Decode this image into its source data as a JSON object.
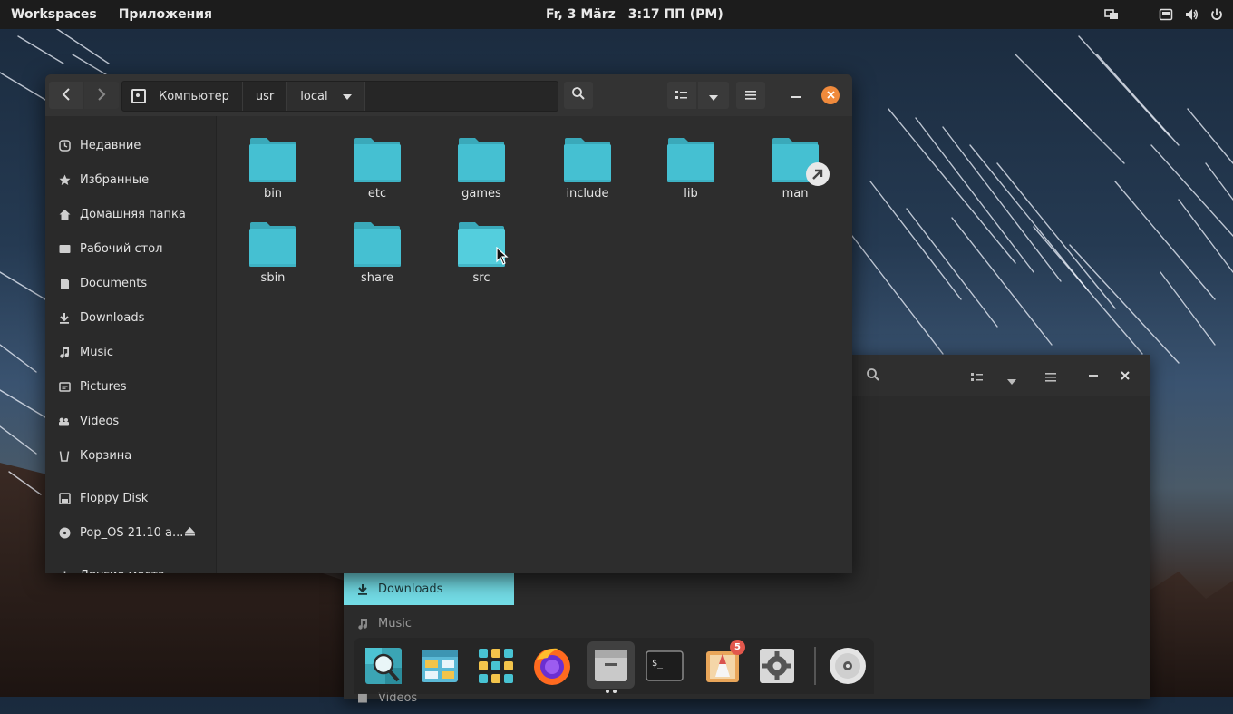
{
  "topbar": {
    "workspaces": "Workspaces",
    "apps": "Приложения",
    "date": "Fr, 3 März",
    "time": "3:17 ПП (PM)"
  },
  "window": {
    "pathbar": [
      "Компьютер",
      "usr",
      "local"
    ]
  },
  "sidebar": {
    "items": [
      {
        "label": "Недавние",
        "icon": "clock-icon"
      },
      {
        "label": "Избранные",
        "icon": "star-icon"
      },
      {
        "label": "Домашняя папка",
        "icon": "home-icon"
      },
      {
        "label": "Рабочий стол",
        "icon": "desktop-icon"
      },
      {
        "label": "Documents",
        "icon": "document-icon"
      },
      {
        "label": "Downloads",
        "icon": "download-icon"
      },
      {
        "label": "Music",
        "icon": "music-icon"
      },
      {
        "label": "Pictures",
        "icon": "picture-icon"
      },
      {
        "label": "Videos",
        "icon": "video-icon"
      },
      {
        "label": "Корзина",
        "icon": "trash-icon"
      },
      {
        "label": "Floppy Disk",
        "icon": "floppy-icon"
      },
      {
        "label": "Pop_OS 21.10 a...",
        "icon": "disc-icon"
      },
      {
        "label": "Другие места",
        "icon": "plus-icon"
      }
    ]
  },
  "folders": [
    "bin",
    "etc",
    "games",
    "include",
    "lib",
    "man",
    "sbin",
    "share",
    "src"
  ],
  "back_window": {
    "items": [
      {
        "label": "Downloads",
        "active": true
      },
      {
        "label": "Music",
        "active": false
      },
      {
        "label": "Videos",
        "active": false
      }
    ]
  },
  "dock": {
    "apps": [
      {
        "name": "popsicle-search-icon"
      },
      {
        "name": "app-center-icon"
      },
      {
        "name": "app-grid-icon"
      },
      {
        "name": "firefox-icon"
      },
      {
        "name": "files-icon",
        "running": true
      },
      {
        "name": "terminal-icon"
      },
      {
        "name": "pop-shop-icon",
        "badge": "5"
      },
      {
        "name": "settings-gear-icon"
      },
      {
        "name": "disc-drive-icon"
      }
    ]
  },
  "colors": {
    "folder": "#45c0d2",
    "folder_tab": "#3aa9ba",
    "accent": "#73dce6",
    "close": "#f08a3c"
  }
}
